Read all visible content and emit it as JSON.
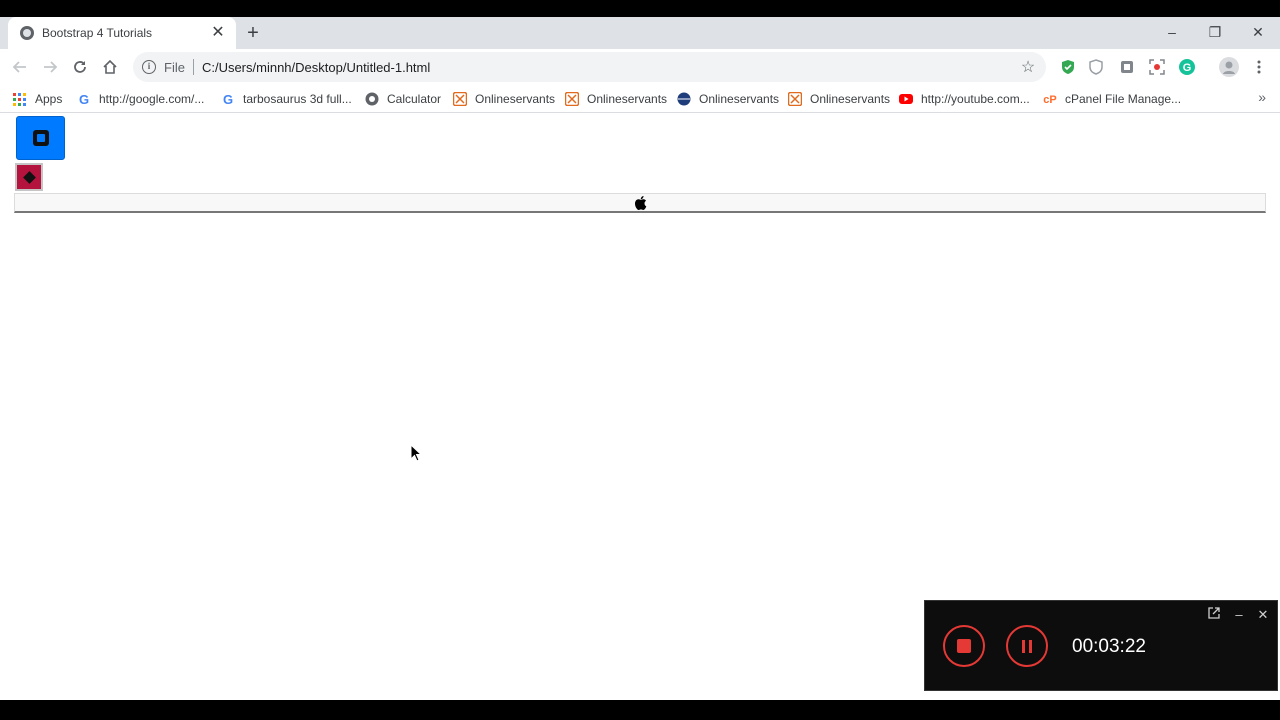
{
  "browser": {
    "tab_title": "Bootstrap 4 Tutorials",
    "tab_close": "✕",
    "new_tab": "+",
    "address": {
      "scheme": "File",
      "url": "C:/Users/minnh/Desktop/Untitled-1.html"
    },
    "window_controls": {
      "minimize": "–",
      "restore": "❐",
      "close": "✕"
    }
  },
  "bookmarks": [
    {
      "label": "Apps",
      "icon": "apps-grid-icon"
    },
    {
      "label": "http://google.com/...",
      "icon": "google-icon"
    },
    {
      "label": "tarbosaurus 3d full...",
      "icon": "google-icon"
    },
    {
      "label": "Calculator",
      "icon": "globe-icon"
    },
    {
      "label": "Onlineservants",
      "icon": "joomla-icon"
    },
    {
      "label": "Onlineservants",
      "icon": "joomla-icon"
    },
    {
      "label": "Onlineservants",
      "icon": "globe-icon"
    },
    {
      "label": "Onlineservants",
      "icon": "joomla-icon"
    },
    {
      "label": "http://youtube.com...",
      "icon": "youtube-icon"
    },
    {
      "label": "cPanel File Manage...",
      "icon": "cpanel-icon"
    }
  ],
  "page": {
    "primary_button_icon": "square-icon",
    "danger_button_icon": "diamond-icon",
    "bar_icon": "apple-icon",
    "colors": {
      "primary": "#007bff",
      "danger": "#b3133d"
    }
  },
  "recorder": {
    "time": "00:03:22",
    "accent": "#e53935"
  }
}
